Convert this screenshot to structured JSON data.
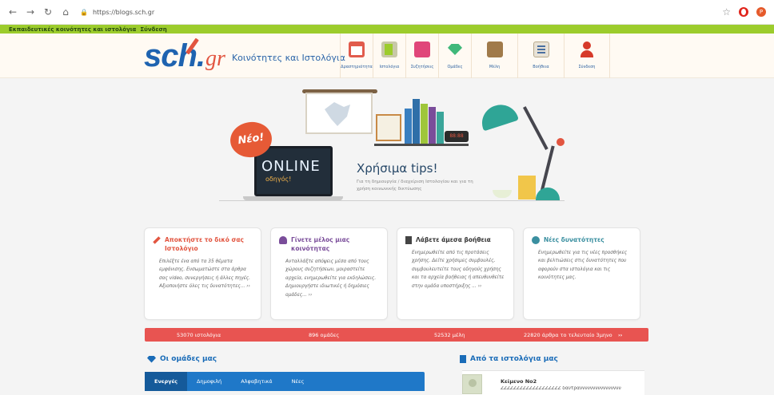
{
  "browser": {
    "url": "https://blogs.sch.gr",
    "ext_label": "P"
  },
  "greenbar": {
    "text": "Εκπαιδευτικές κοινότητες και ιστολόγια",
    "login": "Σύνδεση"
  },
  "header": {
    "logo_main": "sch.",
    "logo_gr": "gr",
    "tagline": "Κοινότητες και Ιστολόγια",
    "nav": [
      {
        "label": "Δραστηριότητα",
        "icon": "calendar-icon"
      },
      {
        "label": "Ιστολόγια",
        "icon": "blog-icon"
      },
      {
        "label": "Συζητήσεις",
        "icon": "chat-icon"
      },
      {
        "label": "Ομάδες",
        "icon": "gem-icon"
      },
      {
        "label": "Μέλη",
        "icon": "book-icon"
      },
      {
        "label": "Βοήθεια",
        "icon": "help-icon"
      },
      {
        "label": "Σύνδεση",
        "icon": "user-icon"
      }
    ]
  },
  "hero": {
    "badge": "Νέο!",
    "screen_title": "ONLINE",
    "screen_sub": "οδηγός!",
    "title": "Χρήσιμα tips!",
    "subtitle": "Για τη δημιουργία / διαχείριση Ιστολογίου και για τη χρήση κοινωνικής δικτύωσης"
  },
  "cards": [
    {
      "title": "Αποκτήστε το δικό σας Ιστολόγιο",
      "body": "Επιλέξτε ένα από τα 35 θέματα εμφάνισης. Ενσωματώστε στα άρθρα σας video, συνεργήσεις ή άλλες πηγές. Αξιοποιήστε όλες τις δυνατότητες... ››"
    },
    {
      "title": "Γίνετε μέλος μιας κοινότητας",
      "body": "Ανταλλάξτε απόψεις μέσα από τους χώρους συζητήσεων, μοιραστείτε αρχεία, ενημερωθείτε για εκδηλώσεις. Δημιουργήστε ιδιωτικές ή δημόσιες ομάδες... ››"
    },
    {
      "title": "Λάβετε άμεσα βοήθεια",
      "body": "Ενημερωθείτε από τις προτάσεις χρήσης. Δείτε χρήσιμες συμβουλές, συμβουλευτείτε τους οδηγούς χρήσης και τα αρχεία βοήθειας ή απευθυνθείτε στην ομάδα υποστήριξης ... ››"
    },
    {
      "title": "Νέες δυνατότητες",
      "body": "Ενημερωθείτε για τις νέες προσθήκες και βελτιώσεις στις δυνατότητες που αφορούν στα ιστολόγια και τις κοινότητες μας."
    }
  ],
  "stats": {
    "blogs": "53070 ιστολόγια",
    "groups": "896 ομάδες",
    "members": "52532 μέλη",
    "articles": "22820 άρθρα το τελευταίο 3μηνο",
    "more": "››"
  },
  "groups": {
    "title": "Οι ομάδες μας",
    "tabs": [
      "Ενεργές",
      "Δημοφιλή",
      "Αλφαβητικά",
      "Νέες"
    ]
  },
  "blogs": {
    "title": "Από τα ιστολόγια μας",
    "item_name": "Κείμενο Νο2",
    "item_text": "ΖΖΖΖΖΖΖΖΖΖΖΖΖΖΖΖΖΖΖ δαντρανννννννννννννννν"
  }
}
